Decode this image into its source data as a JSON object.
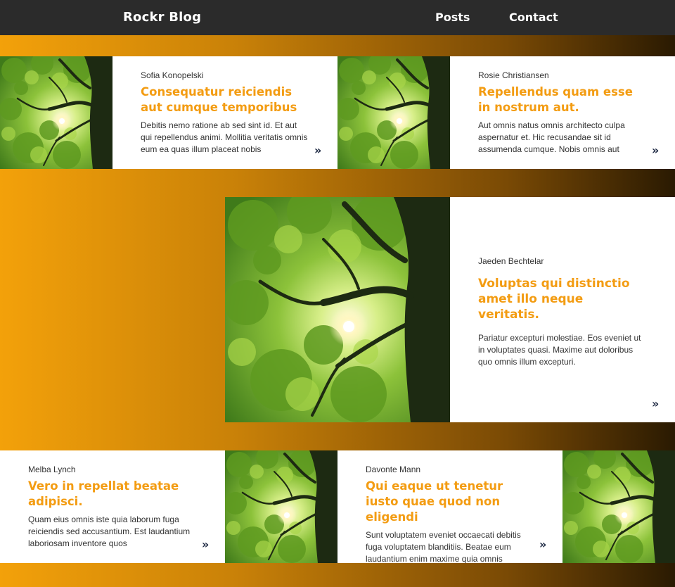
{
  "header": {
    "brand": "Rockr Blog",
    "nav": [
      "Posts",
      "Contact"
    ]
  },
  "icons": {
    "read_more": "double-chevron-right-icon",
    "arrow_glyph": "»",
    "thumbnail": "tree-canopy-image"
  },
  "colors": {
    "accent": "#f39c12",
    "header_bg": "#2b2b2b",
    "arrow": "#1f2a44"
  },
  "posts": [
    {
      "author": "Sofia Konopelski",
      "title": "Consequatur reiciendis aut cumque temporibus",
      "excerpt": "Debitis nemo ratione ab sed sint id. Et aut qui repellendus animi. Mollitia veritatis omnis eum ea quas illum placeat nobis"
    },
    {
      "author": "Rosie Christiansen",
      "title": "Repellendus quam esse in nostrum aut.",
      "excerpt": "Aut omnis natus omnis architecto culpa aspernatur et. Hic recusandae sit id assumenda cumque. Nobis omnis aut"
    },
    {
      "author": "Jaeden Bechtelar",
      "title": "Voluptas qui distinctio amet illo neque veritatis.",
      "excerpt": "Pariatur excepturi molestiae. Eos eveniet ut in voluptates quasi. Maxime aut doloribus quo omnis illum excepturi."
    },
    {
      "author": "Melba Lynch",
      "title": "Vero in repellat beatae adipisci.",
      "excerpt": "Quam eius omnis iste quia laborum fuga reiciendis sed accusantium. Est laudantium laboriosam inventore quos"
    },
    {
      "author": "Davonte Mann",
      "title": "Qui eaque ut tenetur iusto quae quod non eligendi",
      "excerpt": "Sunt voluptatem eveniet occaecati debitis fuga voluptatem blanditiis. Beatae eum laudantium enim maxime quia omnis"
    }
  ]
}
